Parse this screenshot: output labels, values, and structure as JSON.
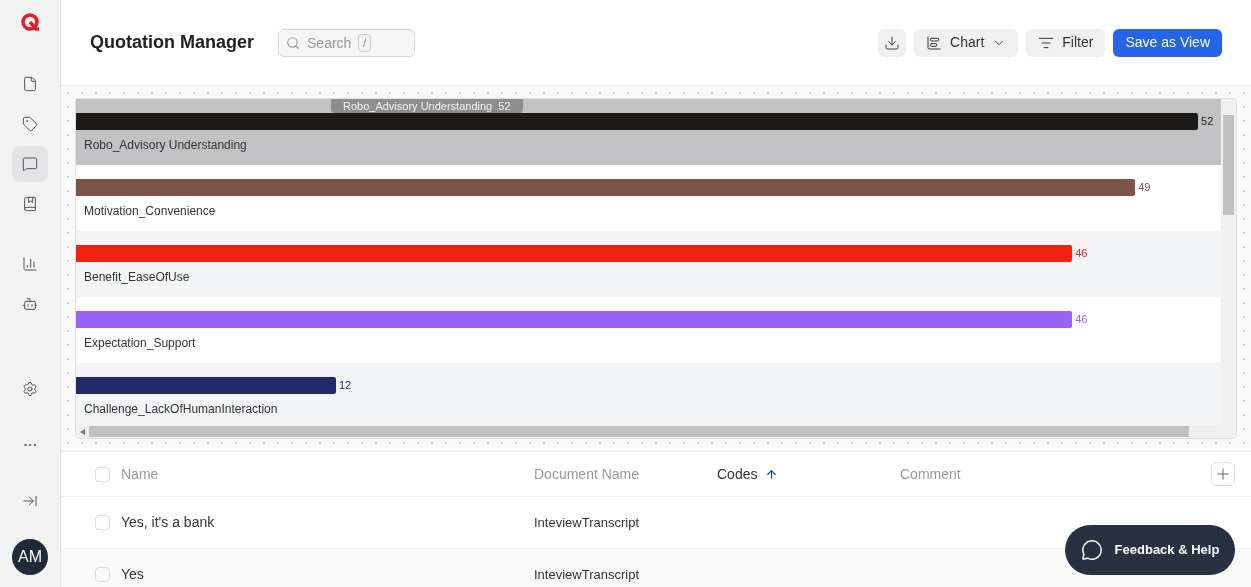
{
  "sidebar": {
    "avatar": "AM",
    "items": [
      {
        "kind": "file",
        "selected": false
      },
      {
        "kind": "tag",
        "selected": false
      },
      {
        "kind": "message",
        "selected": true
      },
      {
        "kind": "bookmark",
        "selected": false
      },
      {
        "kind": "chart",
        "selected": false
      },
      {
        "kind": "bot",
        "selected": false
      }
    ],
    "bottom_items": [
      {
        "kind": "settings"
      },
      {
        "kind": "more"
      },
      {
        "kind": "collapse"
      }
    ]
  },
  "header": {
    "title": "Quotation Manager",
    "search": {
      "placeholder": "Search",
      "shortcut": "/"
    },
    "buttons": [
      {
        "kind": "download"
      },
      {
        "kind": "chart",
        "label": "Chart"
      },
      {
        "kind": "filter",
        "label": "Filter"
      },
      {
        "kind": "primary",
        "label": "Save as View"
      }
    ]
  },
  "chart": {
    "tooltip": "Robo_Advisory Understanding  52",
    "bars": [
      {
        "label": "Robo_Advisory Understanding",
        "value": "52",
        "color": "#1c1919",
        "level": 0.98,
        "selected": true
      },
      {
        "label": "Motivation_Convenience",
        "value": "49",
        "color": "#7a5548",
        "level": 0.925,
        "selected": false
      },
      {
        "label": "Benefit_EaseOfUse",
        "value": "46",
        "color": "#f22210",
        "level": 0.87,
        "selected": false
      },
      {
        "label": "Expectation_Support",
        "value": "46",
        "color": "#9b62f5",
        "level": 0.87,
        "selected": false
      },
      {
        "label": "Challenge_LackOfHumanInteraction",
        "value": "12",
        "color": "#222a6e",
        "level": 0.227,
        "selected": false
      }
    ]
  },
  "table": {
    "all_checked": false,
    "columns": [
      {
        "label": "Name",
        "sorted": false
      },
      {
        "label": "Document Name",
        "sorted": false
      },
      {
        "label": "Codes",
        "sorted": true
      },
      {
        "label": "Comment",
        "sorted": false
      }
    ],
    "rows": [
      {
        "checked": false,
        "cells": [
          "Yes, it's a bank",
          "InteviewTranscript"
        ]
      },
      {
        "checked": false,
        "cells": [
          "Yes",
          "InteviewTranscript"
        ]
      }
    ]
  },
  "feedback_button": "Feedback & Help"
}
